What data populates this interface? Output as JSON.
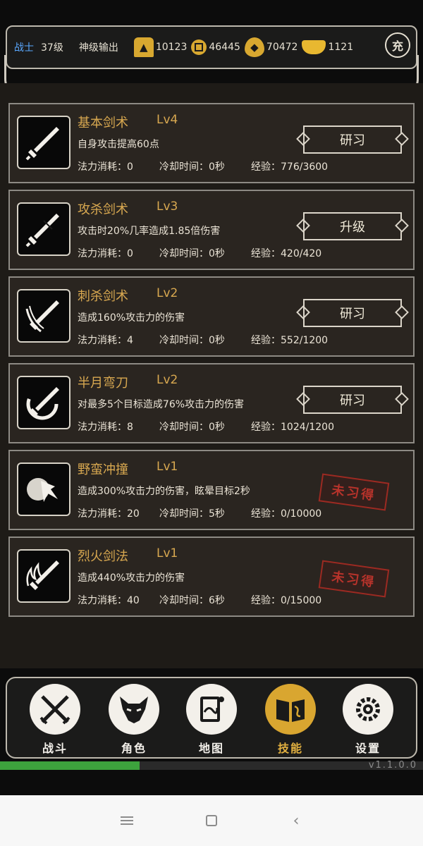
{
  "status": {
    "class": "战士",
    "level": "37级",
    "title": "神级输出",
    "resources": [
      {
        "icon": "flame-gold-icon",
        "value": "10123"
      },
      {
        "icon": "coin-icon",
        "value": "46445"
      },
      {
        "icon": "gold-drop-icon",
        "value": "70472"
      },
      {
        "icon": "gold-ingot-icon",
        "value": "1121"
      }
    ],
    "charge_label": "充"
  },
  "skills": [
    {
      "name": "基本剑术",
      "level": "Lv4",
      "desc": "自身攻击提高60点",
      "mana": "法力消耗：0",
      "cooldown": "冷却时间：0秒",
      "exp": "经验：776/3600",
      "action": "研习",
      "icon": "sword-icon"
    },
    {
      "name": "攻杀剑术",
      "level": "Lv3",
      "desc": "攻击时20%几率造成1.85倍伤害",
      "mana": "法力消耗：0",
      "cooldown": "冷却时间：0秒",
      "exp": "经验：420/420",
      "action": "升级",
      "icon": "sword-icon"
    },
    {
      "name": "刺杀剑术",
      "level": "Lv2",
      "desc": "造成160%攻击力的伤害",
      "mana": "法力消耗：4",
      "cooldown": "冷却时间：0秒",
      "exp": "经验：552/1200",
      "action": "研习",
      "icon": "sword-slash-icon"
    },
    {
      "name": "半月弯刀",
      "level": "Lv2",
      "desc": "对最多5个目标造成76%攻击力的伤害",
      "mana": "法力消耗：8",
      "cooldown": "冷却时间：0秒",
      "exp": "经验：1024/1200",
      "action": "研习",
      "icon": "crescent-sword-icon"
    },
    {
      "name": "野蛮冲撞",
      "level": "Lv1",
      "desc": "造成300%攻击力的伤害，眩晕目标2秒",
      "mana": "法力消耗：20",
      "cooldown": "冷却时间：5秒",
      "exp": "经验：0/10000",
      "stamp": "未习得",
      "icon": "charge-icon"
    },
    {
      "name": "烈火剑法",
      "level": "Lv1",
      "desc": "造成440%攻击力的伤害",
      "mana": "法力消耗：40",
      "cooldown": "冷却时间：6秒",
      "exp": "经验：0/15000",
      "stamp": "未习得",
      "icon": "fire-sword-icon"
    }
  ],
  "nav": [
    {
      "label": "战斗",
      "icon": "crossed-swords-icon",
      "active": false
    },
    {
      "label": "角色",
      "icon": "demon-mask-icon",
      "active": false
    },
    {
      "label": "地图",
      "icon": "scroll-map-icon",
      "active": false
    },
    {
      "label": "技能",
      "icon": "skill-book-icon",
      "active": true
    },
    {
      "label": "设置",
      "icon": "gears-icon",
      "active": false
    }
  ],
  "progress": 0.33,
  "version": "v1.1.0.0",
  "colors": {
    "accent_gold": "#d9a630",
    "class_blue": "#5aa8ff",
    "stamp_red": "#b8332b",
    "progress_green": "#3da23d"
  }
}
